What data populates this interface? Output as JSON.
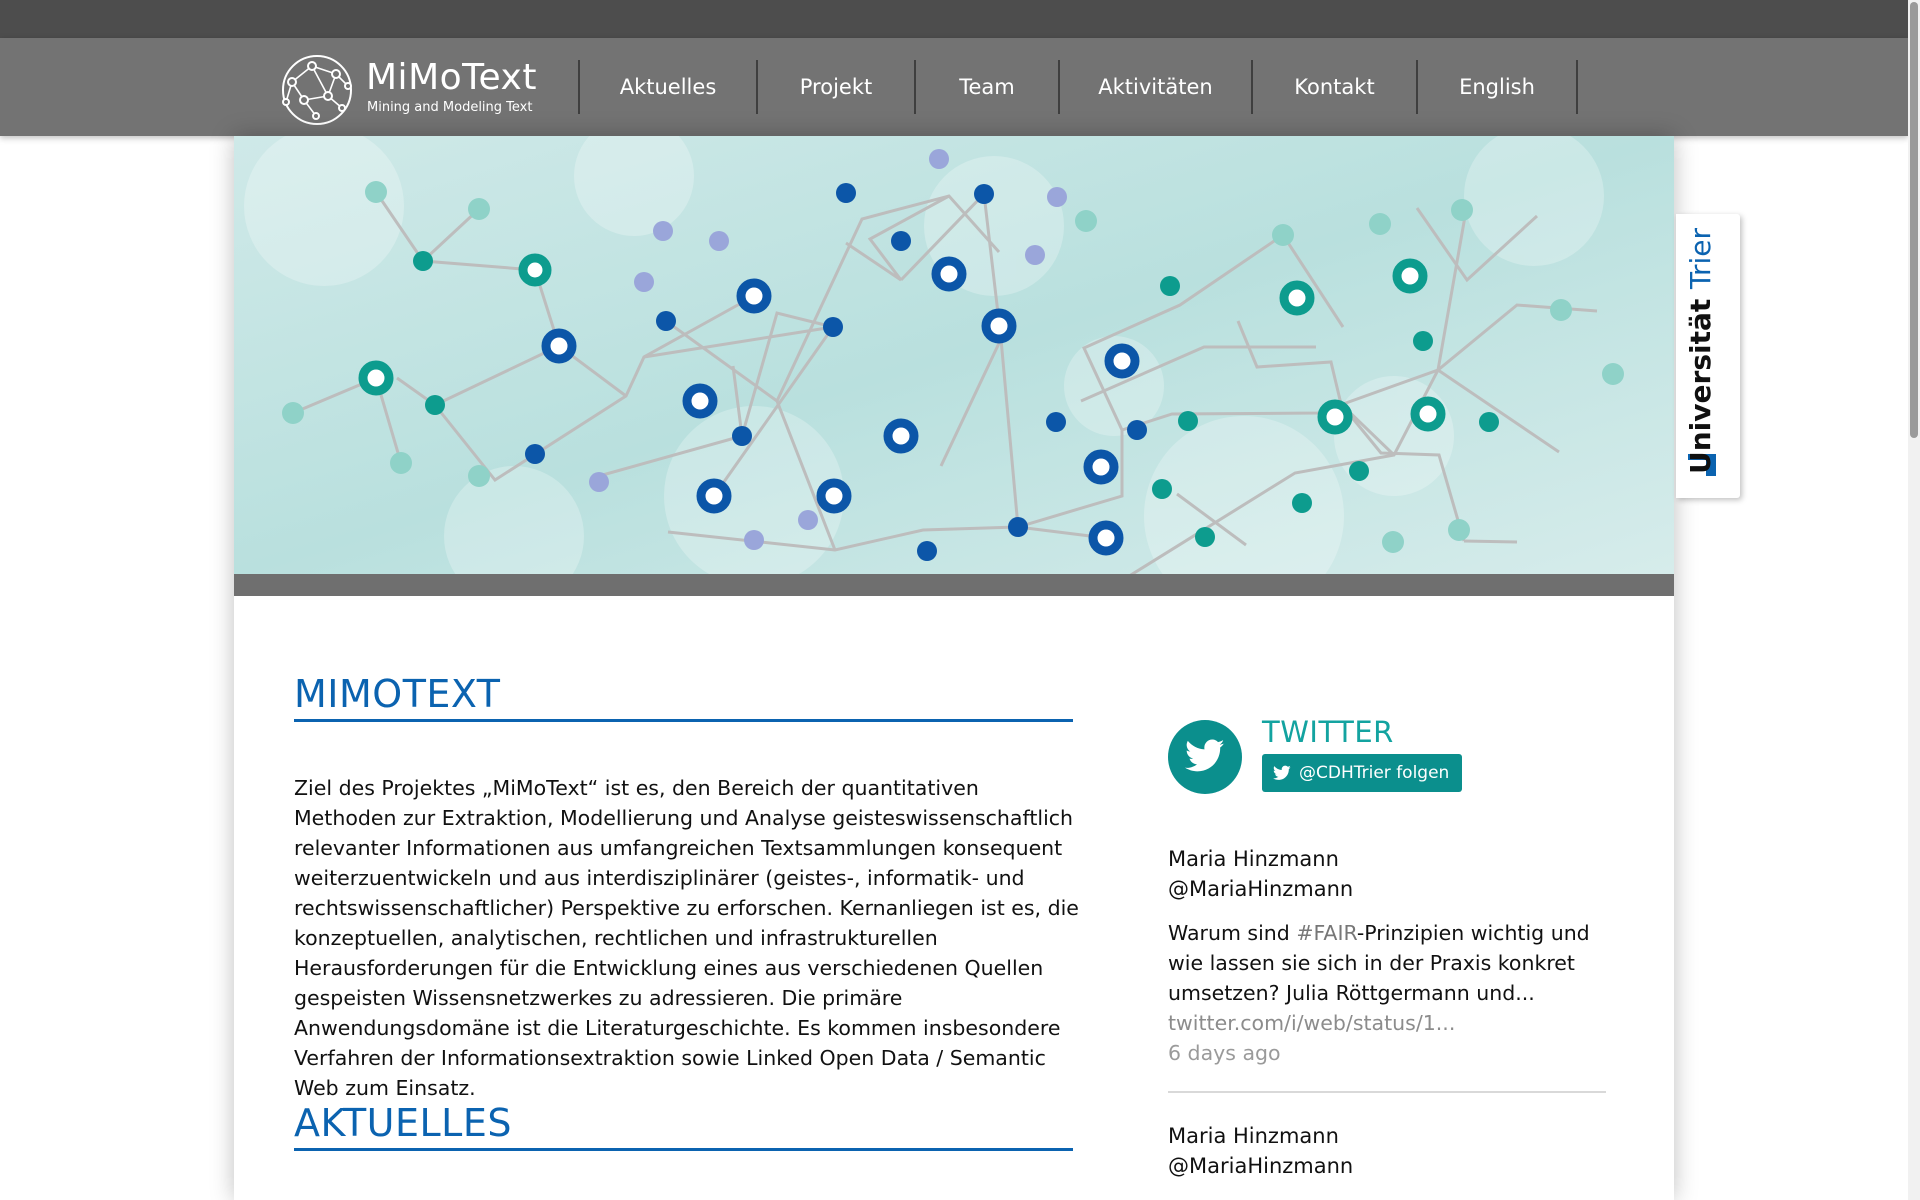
{
  "logo": {
    "title": "MiMoText",
    "subtitle": "Mining and Modeling Text"
  },
  "nav": {
    "items": [
      {
        "label": "Aktuelles"
      },
      {
        "label": "Projekt"
      },
      {
        "label": "Team"
      },
      {
        "label": "Aktivitäten"
      },
      {
        "label": "Kontakt"
      },
      {
        "label": "English"
      }
    ]
  },
  "badge": {
    "part1": "Universität",
    "part2": "Trier"
  },
  "main": {
    "heading": "MIMOTEXT",
    "intro": "Ziel des Projektes „MiMoText“ ist es, den Bereich der quantitativen Methoden zur Extraktion, Modellierung und Analyse geisteswissenschaftlich relevanter Informationen aus umfangreichen Textsammlungen konsequent weiterzuentwickeln und aus interdisziplinärer (geistes-, informatik- und rechtswissenschaftlicher) Perspektive zu erforschen. Kernanliegen ist es, die konzeptuellen, analytischen, rechtlichen und infrastrukturellen Herausforderungen für die Entwicklung eines aus verschiedenen Quellen gespeisten Wissensnetzwerkes zu adressieren. Die primäre Anwendungsdomäne ist die Literaturgeschichte. Es kommen insbesondere Verfahren der Informationsextraktion sowie Linked Open Data / Semantic Web zum Einsatz.",
    "heading2": "AKTUELLES"
  },
  "twitter": {
    "title": "TWITTER",
    "follow_label": "@CDHTrier folgen",
    "tweets": [
      {
        "name": "Maria Hinzmann",
        "handle": "@MariaHinzmann",
        "text_before": "Warum sind ",
        "hashtag": "#FAIR",
        "text_after": "-Prinzipien wichtig und wie lassen sie sich in der Praxis konkret umsetzen? Julia Röttgermann und...",
        "link": "twitter.com/i/web/status/1...",
        "time": "6 days ago"
      },
      {
        "name": "Maria Hinzmann",
        "handle": "@MariaHinzmann"
      }
    ]
  },
  "colors": {
    "nav_bg": "#737373",
    "accent_blue": "#0b63b0",
    "accent_teal": "#0b8f8d"
  }
}
